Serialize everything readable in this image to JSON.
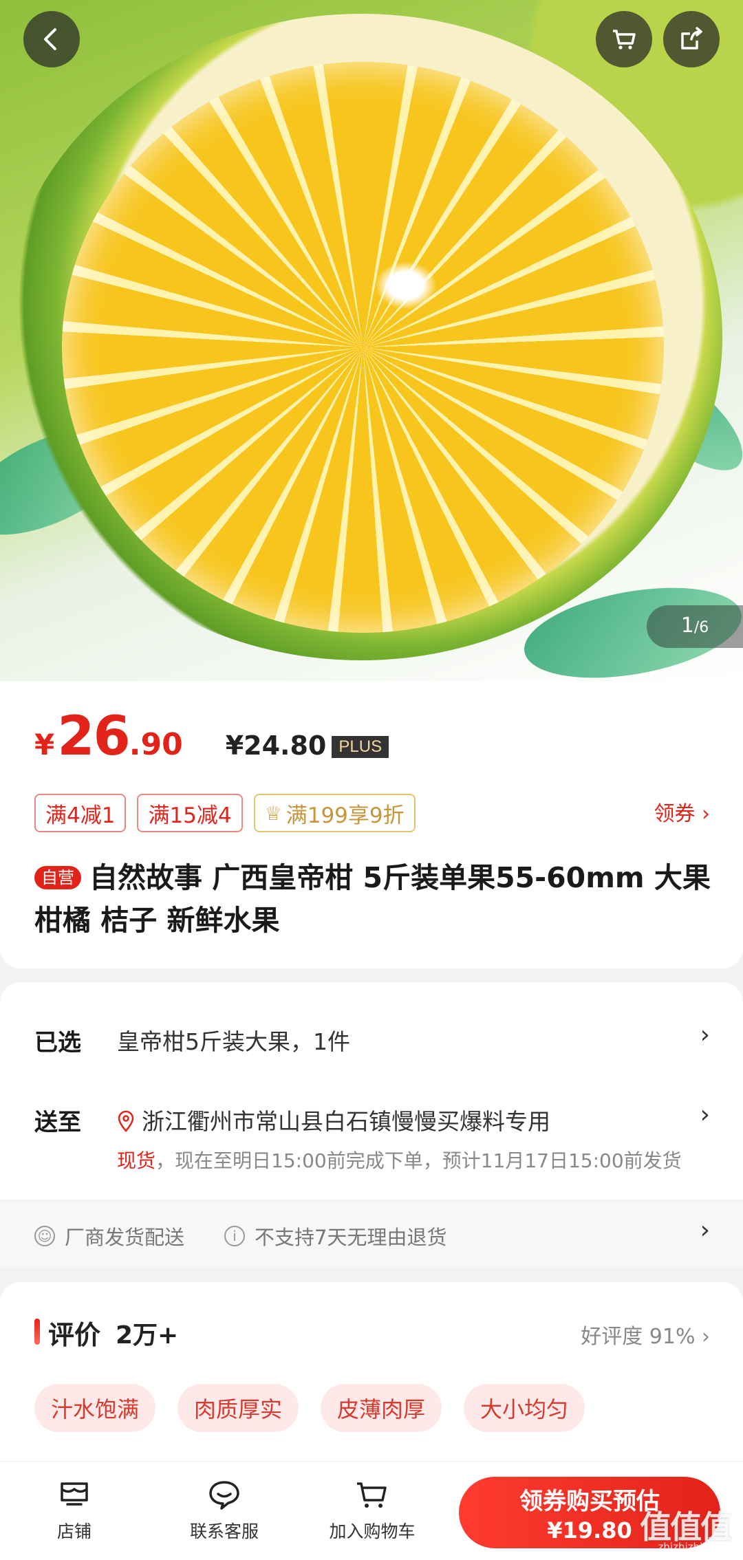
{
  "gallery": {
    "page_current": "1",
    "page_total": "/6"
  },
  "price": {
    "currency": "¥",
    "integer": "26",
    "decimal": ".90",
    "plus_price": "¥24.80",
    "plus_label": "PLUS"
  },
  "coupons": [
    {
      "label": "满4减1"
    },
    {
      "label": "满15减4"
    },
    {
      "label": "满199享9折"
    }
  ],
  "get_coupon_label": "领券 ›",
  "product": {
    "badge": "自营",
    "title": "自然故事 广西皇帝柑 5斤装单果55-60mm 大果 柑橘 桔子 新鲜水果"
  },
  "selection": {
    "selected_label": "已选",
    "selected_value": "皇帝柑5斤装大果，1件",
    "ship_label": "送至",
    "address": "浙江衢州市常山县白石镇慢慢买爆料专用",
    "stock_tag": "现货",
    "stock_text": "，现在至明日15:00前完成下单，预计11月17日15:00前发货",
    "chevron": "›"
  },
  "services": [
    {
      "icon": "☺",
      "text": "厂商发货配送"
    },
    {
      "icon": "i",
      "text": "不支持7天无理由退货"
    }
  ],
  "reviews": {
    "title": "评价",
    "count": "2万+",
    "rating": "好评度 91% ›",
    "tags": [
      "汁水饱满",
      "肉质厚实",
      "皮薄肉厚",
      "大小均匀"
    ]
  },
  "bottom_bar": {
    "shop": "店铺",
    "service": "联系客服",
    "cart": "加入购物车",
    "buy_line1": "领券购买预估",
    "buy_line2": "¥19.80"
  },
  "watermark": {
    "text": "值值值",
    "sub": "zhizhizhi.com"
  },
  "colors": {
    "accent": "#e2231a",
    "coupon_gold": "#c7953a"
  }
}
